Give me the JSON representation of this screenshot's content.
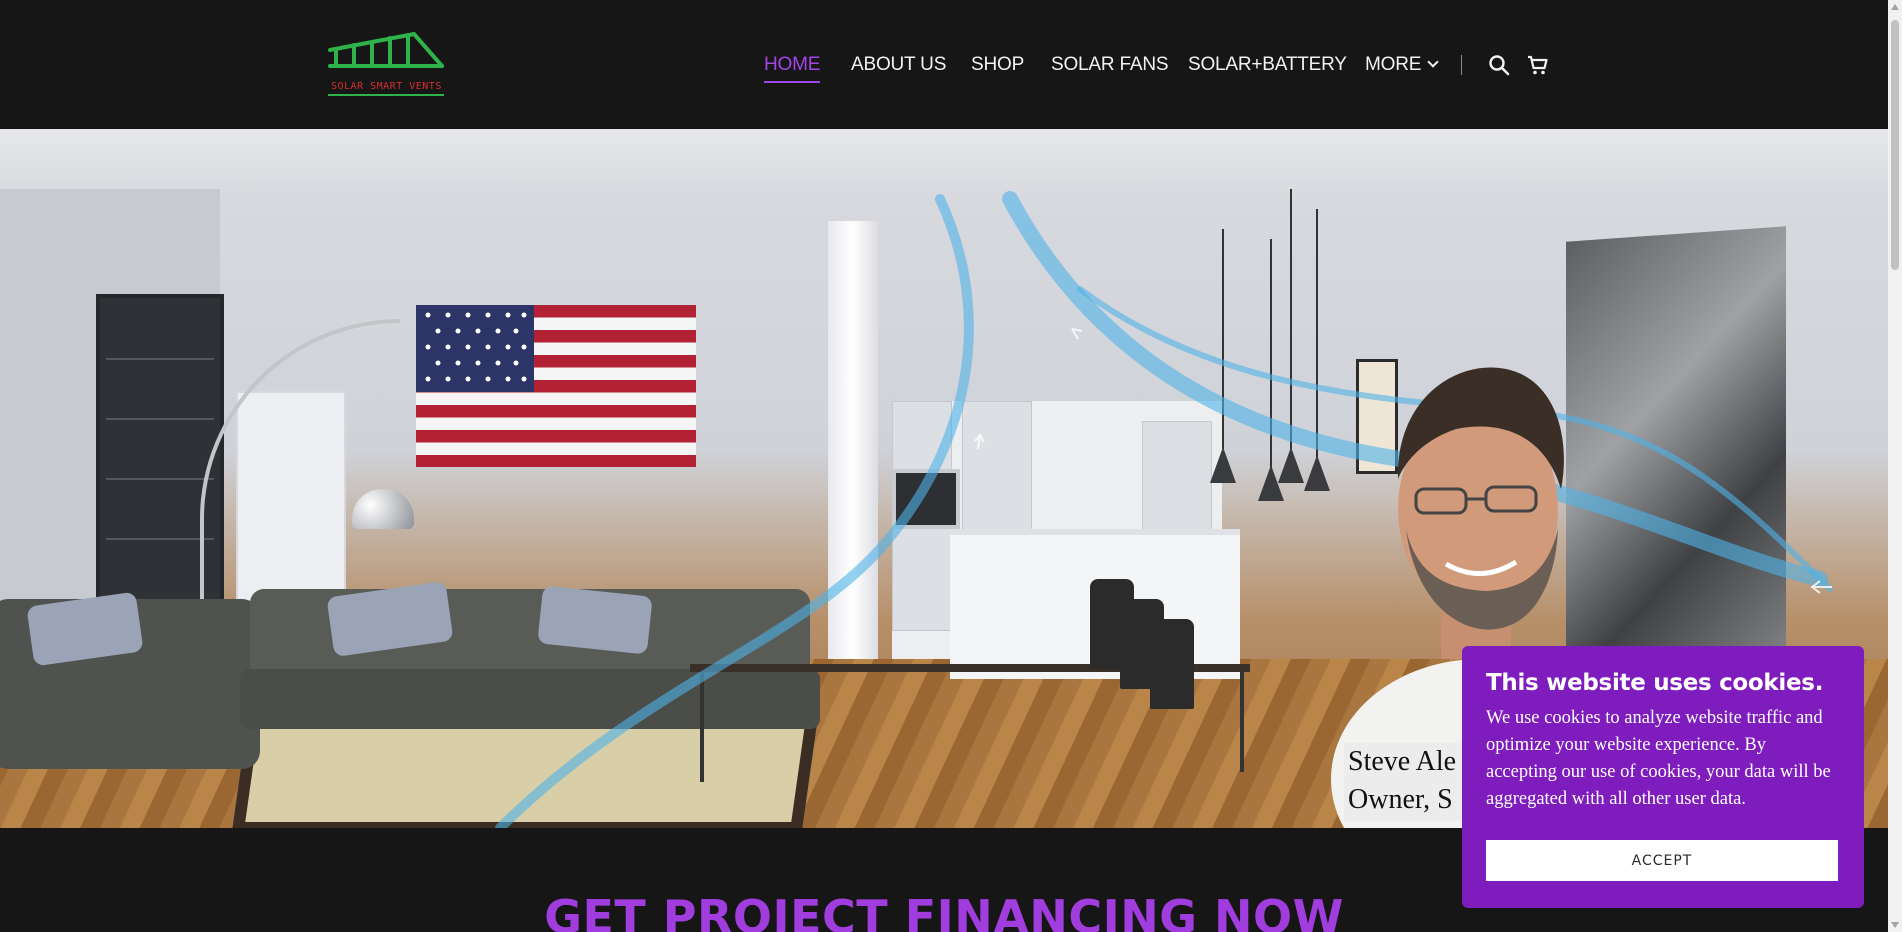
{
  "brand": {
    "logo_text": "SOLAR SMART VENTS",
    "logo_icon": "solar-panel-rack-icon",
    "logo_color": "#2db34a",
    "logo_text_color": "#d32f2f"
  },
  "nav": {
    "items": [
      {
        "label": "HOME",
        "active": true
      },
      {
        "label": "ABOUT US",
        "active": false
      },
      {
        "label": "SHOP",
        "active": false
      },
      {
        "label": "SOLAR FANS",
        "active": false
      },
      {
        "label": "SOLAR+BATTERY",
        "active": false
      },
      {
        "label": "MORE",
        "active": false,
        "has_dropdown": true
      }
    ],
    "icons": [
      "search-icon",
      "cart-icon"
    ],
    "active_color": "#a445e8"
  },
  "hero": {
    "caption_line1": "Steve Ale",
    "caption_line2": "Owner, S"
  },
  "section": {
    "title": "GET PROJECT FINANCING NOW",
    "title_color": "#a13dde"
  },
  "cookie": {
    "title": "This website uses cookies.",
    "text": "We use cookies to analyze website traffic and optimize your website experience. By accepting our use of cookies, your data will be aggregated with all other user data.",
    "accept_label": "ACCEPT",
    "background": "#7f1cbd"
  }
}
